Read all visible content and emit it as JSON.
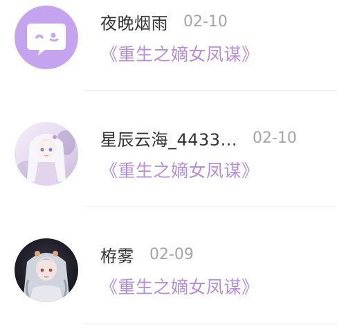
{
  "comments": [
    {
      "username": "夜晚烟雨",
      "date": "02-10",
      "book": "《重生之嫡女凤谋》",
      "avatar": {
        "kind": "default-chat-avatar",
        "bg": "#c4a4ef"
      }
    },
    {
      "username": "星辰云海_4433...",
      "date": "02-10",
      "book": "《重生之嫡女凤谋》",
      "avatar": {
        "kind": "anime-girl-white-hair",
        "bg": "#ece6f2"
      }
    },
    {
      "username": "栫雾",
      "date": "02-09",
      "book": "《重生之嫡女凤谋》",
      "avatar": {
        "kind": "anime-girl-dark-bg",
        "bg": "#1e1e2a"
      }
    }
  ],
  "colors": {
    "username": "#333333",
    "date": "#a5a5a5",
    "book_link": "#b48ede",
    "default_avatar": "#c4a4ef"
  }
}
